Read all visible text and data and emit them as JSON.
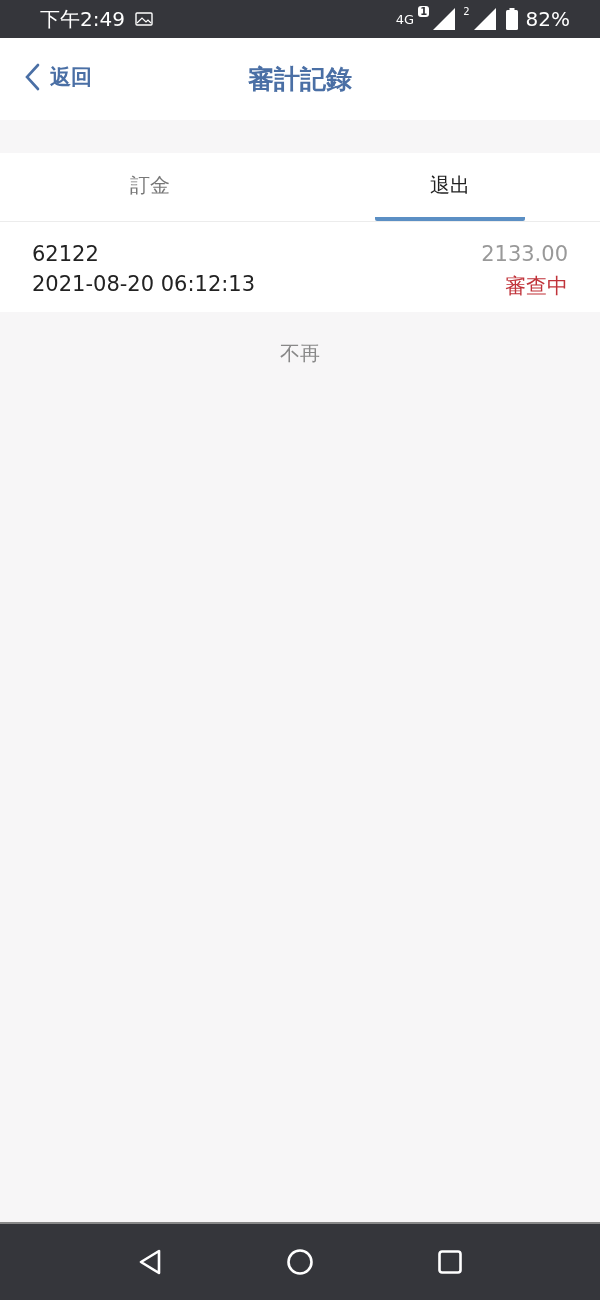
{
  "status_bar": {
    "time": "下午2:49",
    "network": "4G",
    "sim_1": "1",
    "sim_2": "2",
    "battery": "82%"
  },
  "header": {
    "back": "返回",
    "title": "審計記錄"
  },
  "tabs": [
    {
      "label": "訂金",
      "selected": false
    },
    {
      "label": "退出",
      "selected": true
    }
  ],
  "records": [
    {
      "id": "62122",
      "amount": "2133.00",
      "time": "2021-08-20 06:12:13",
      "status": "審查中"
    }
  ],
  "footer_note": "不再"
}
